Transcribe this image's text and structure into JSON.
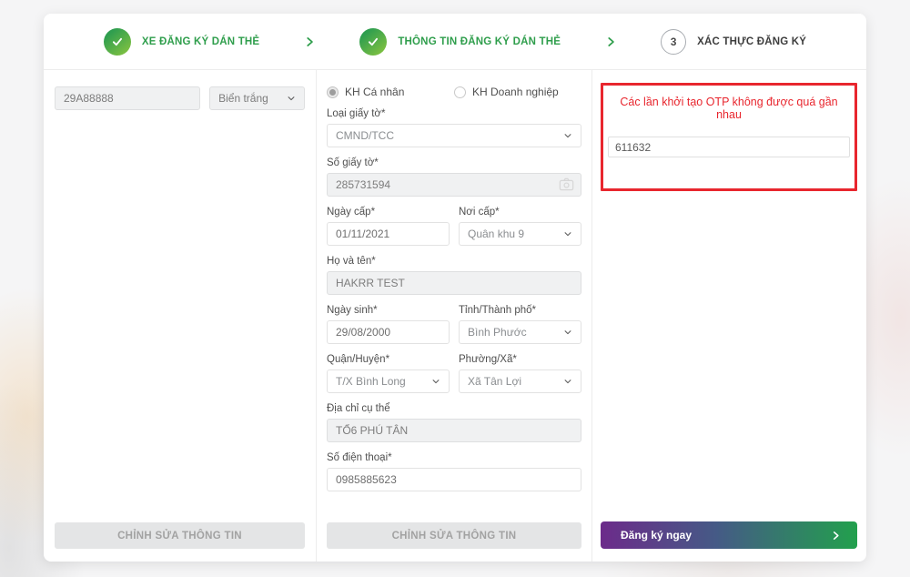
{
  "stepper": {
    "steps": [
      {
        "label": "XE ĐĂNG KÝ DÁN THẺ",
        "state": "done"
      },
      {
        "label": "THÔNG TIN ĐĂNG KÝ DÁN THẺ",
        "state": "done"
      },
      {
        "label": "XÁC THỰC ĐĂNG KÝ",
        "state": "current",
        "number": "3"
      }
    ]
  },
  "vehicle": {
    "plate_value": "29A88888",
    "plate_type_value": "Biển trắng",
    "edit_button_label": "CHỈNH SỬA THÔNG TIN"
  },
  "customer": {
    "type_personal_label": "KH Cá nhân",
    "type_business_label": "KH Doanh nghiệp",
    "doc_type_label": "Loại giấy tờ*",
    "doc_type_value": "CMND/TCC",
    "doc_number_label": "Số giấy tờ*",
    "doc_number_value": "285731594",
    "issue_date_label": "Ngày cấp*",
    "issue_date_value": "01/11/2021",
    "issue_place_label": "Nơi cấp*",
    "issue_place_value": "Quân khu 9",
    "fullname_label": "Họ và tên*",
    "fullname_value": "HAKRR TEST",
    "dob_label": "Ngày sinh*",
    "dob_value": "29/08/2000",
    "province_label": "Tỉnh/Thành phố*",
    "province_value": "Bình Phước",
    "district_label": "Quận/Huyện*",
    "district_value": "T/X Bình Long",
    "ward_label": "Phường/Xã*",
    "ward_value": "Xã Tân Lợi",
    "address_label": "Địa chỉ cụ thể",
    "address_value": "TỔ6 PHÚ TÂN",
    "phone_label": "Số điện thoại*",
    "phone_value": "0985885623",
    "edit_button_label": "CHỈNH SỬA THÔNG TIN"
  },
  "otp": {
    "warning_text": "Các lần khởi tạo OTP không được quá gần nhau",
    "code_value": "611632",
    "register_button_label": "Đăng ký ngay"
  },
  "colors": {
    "accent_green": "#2f9e4c",
    "alert_red": "#e8262e",
    "gradient_start": "#6c2b8a",
    "gradient_end": "#22a04d"
  }
}
